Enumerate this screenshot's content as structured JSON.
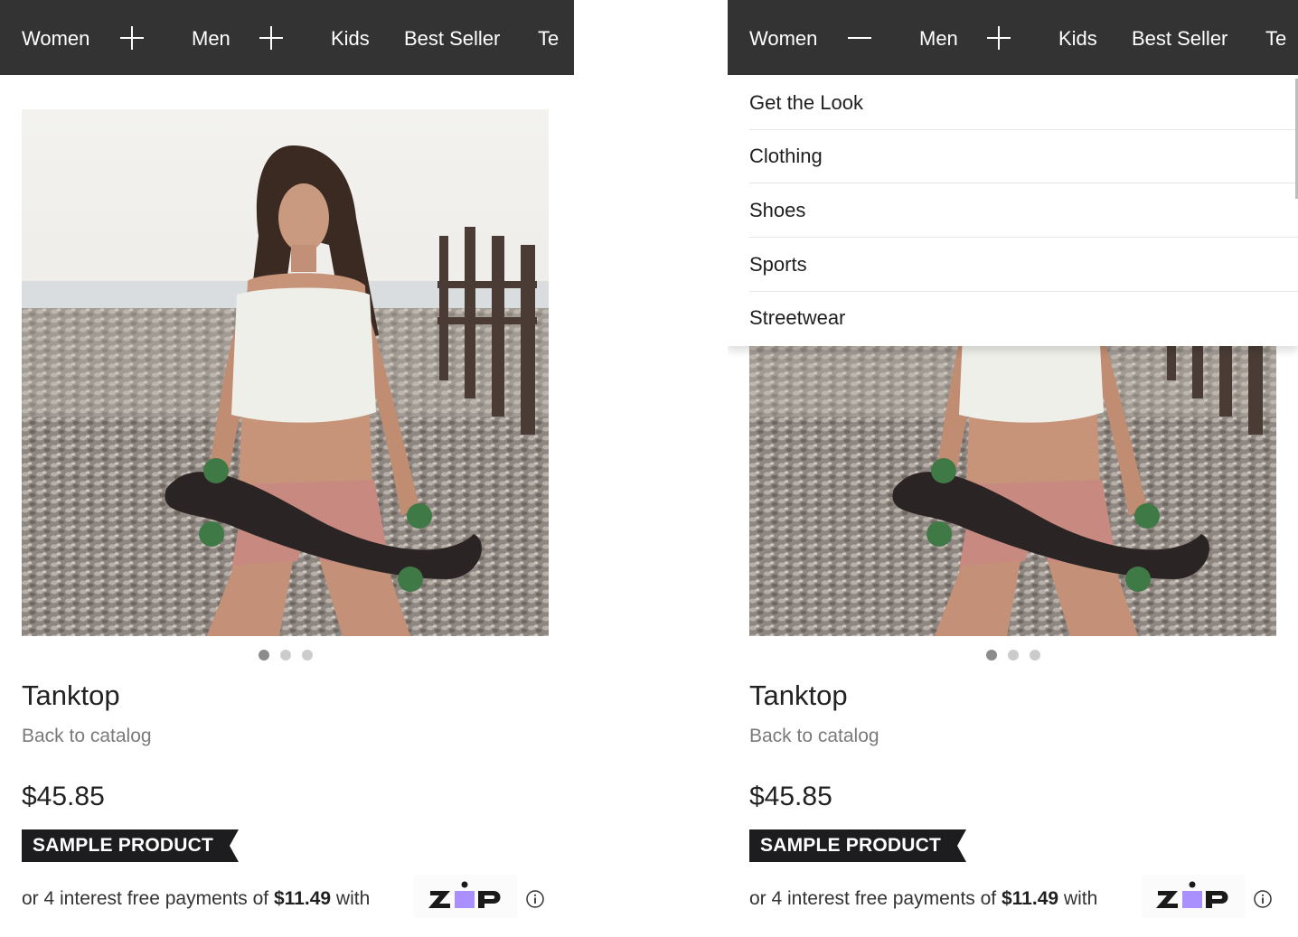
{
  "nav": {
    "items": [
      "Women",
      "Men",
      "Kids",
      "Best Seller",
      "Te"
    ],
    "left_toggles": [
      "plus-icon",
      "plus-icon"
    ],
    "right_toggles": [
      "minus-icon",
      "plus-icon"
    ]
  },
  "dropdown": {
    "open_under": "Women",
    "items": [
      "Get the Look",
      "Clothing",
      "Shoes",
      "Sports",
      "Streetwear"
    ]
  },
  "product": {
    "title": "Tanktop",
    "back_link": "Back to catalog",
    "price": "$45.85",
    "badge": "SAMPLE PRODUCT",
    "carousel": {
      "count": 3,
      "active": 1
    }
  },
  "zip": {
    "prefix": "or 4 interest free payments of",
    "amount": "$11.49",
    "suffix": "with",
    "logo_text": "ZIP",
    "brand_color": "#aa8fff"
  },
  "colors": {
    "nav_bg": "#333333",
    "nav_text": "#ffffff",
    "badge_bg": "#1d1d1f",
    "link_gray": "#7a7a7a"
  }
}
